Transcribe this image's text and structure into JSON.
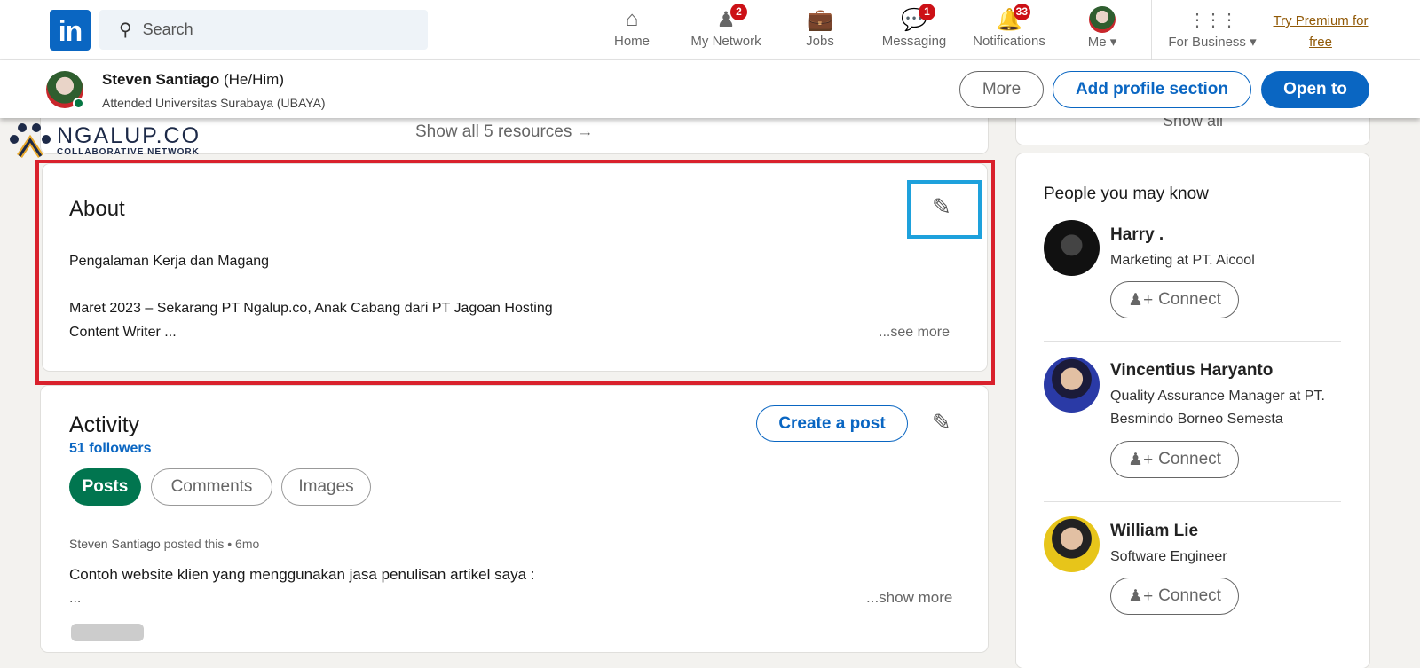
{
  "nav": {
    "search_placeholder": "Search",
    "items": [
      {
        "label": "Home",
        "icon": "home-icon",
        "badge": null
      },
      {
        "label": "My Network",
        "icon": "people-icon",
        "badge": "2"
      },
      {
        "label": "Jobs",
        "icon": "briefcase-icon",
        "badge": null
      },
      {
        "label": "Messaging",
        "icon": "chat-icon",
        "badge": "1"
      },
      {
        "label": "Notifications",
        "icon": "bell-icon",
        "badge": "33"
      },
      {
        "label": "Me ▾",
        "icon": "avatar",
        "badge": null
      }
    ],
    "for_business": "For Business ▾",
    "premium": "Try Premium for free"
  },
  "profile_bar": {
    "name": "Steven Santiago",
    "pronouns": " (He/Him)",
    "subtitle": "Attended Universitas Surabaya (UBAYA)",
    "more": "More",
    "add_section": "Add profile section",
    "open_to": "Open to"
  },
  "resources": {
    "show_all": "Show all 5 resources →"
  },
  "watermark": {
    "name": "NGALUP.CO",
    "tagline": "COLLABORATIVE NETWORK"
  },
  "right_top": {
    "show_all": "Show all"
  },
  "about": {
    "title": "About",
    "line1": "Pengalaman Kerja dan Magang",
    "line2": "Maret 2023 – Sekarang PT Ngalup.co, Anak Cabang dari PT Jagoan Hosting",
    "line3": "Content Writer ...",
    "see_more": "...see more"
  },
  "activity": {
    "title": "Activity",
    "followers": "51 followers",
    "create_post": "Create a post",
    "tabs": [
      "Posts",
      "Comments",
      "Images"
    ],
    "post": {
      "author": "Steven Santiago",
      "meta": " posted this • 6mo",
      "text": "Contoh website klien yang menggunakan jasa penulisan artikel saya :",
      "text2": "...",
      "show_more": "...show more"
    }
  },
  "pymk": {
    "title": "People you may know",
    "people": [
      {
        "name": "Harry .",
        "headline": "Marketing at PT. Aicool",
        "connect": "Connect"
      },
      {
        "name": "Vincentius Haryanto",
        "headline": "Quality Assurance Manager at PT. Besmindo Borneo Semesta",
        "connect": "Connect"
      },
      {
        "name": "William Lie",
        "headline": "Software Engineer",
        "connect": "Connect"
      }
    ]
  },
  "colors": {
    "brand": "#0a66c2",
    "annotation_red": "#d9212c",
    "annotation_blue": "#1ea1dc",
    "posts_green": "#01754f"
  }
}
